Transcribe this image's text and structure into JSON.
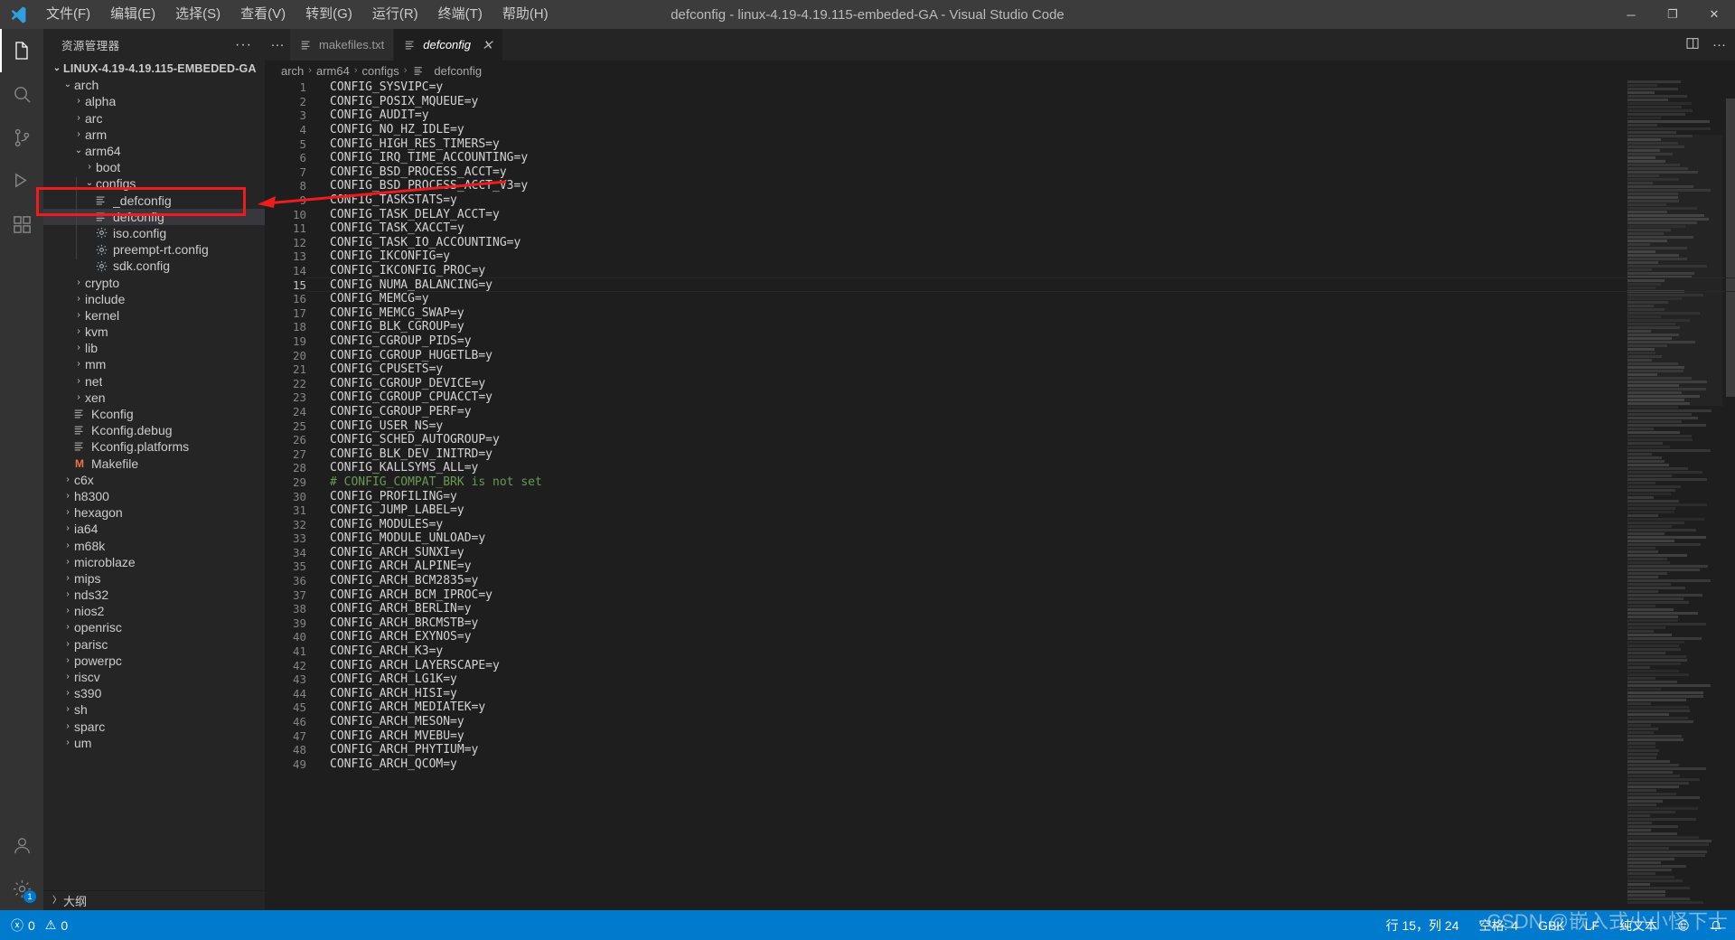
{
  "titlebar": {
    "window_title": "defconfig - linux-4.19-4.19.115-embeded-GA - Visual Studio Code",
    "menus": [
      "文件(F)",
      "编辑(E)",
      "选择(S)",
      "查看(V)",
      "转到(G)",
      "运行(R)",
      "终端(T)",
      "帮助(H)"
    ],
    "minimize": "─",
    "maximize": "❐",
    "close": "✕"
  },
  "activity_bar": {
    "items": [
      {
        "name": "explorer",
        "icon": "files-icon",
        "active": true
      },
      {
        "name": "search",
        "icon": "search-icon",
        "active": false
      },
      {
        "name": "source-control",
        "icon": "source-control-icon",
        "active": false
      },
      {
        "name": "run-and-debug",
        "icon": "debug-icon",
        "active": false
      },
      {
        "name": "extensions",
        "icon": "extensions-icon",
        "active": false
      }
    ],
    "bottom": [
      {
        "name": "accounts",
        "icon": "account-icon",
        "badge": ""
      },
      {
        "name": "manage",
        "icon": "gear-icon",
        "badge": "1"
      }
    ]
  },
  "sidebar": {
    "title": "资源管理器",
    "actions": "···",
    "outline_label": "大纲",
    "tree": [
      {
        "label": "LINUX-4.19-4.19.115-EMBEDED-GA",
        "indent": 0,
        "type": "root",
        "twisty": "open"
      },
      {
        "label": "arch",
        "indent": 1,
        "type": "folder",
        "twisty": "open"
      },
      {
        "label": "alpha",
        "indent": 2,
        "type": "folder",
        "twisty": "closed"
      },
      {
        "label": "arc",
        "indent": 2,
        "type": "folder",
        "twisty": "closed"
      },
      {
        "label": "arm",
        "indent": 2,
        "type": "folder",
        "twisty": "closed"
      },
      {
        "label": "arm64",
        "indent": 2,
        "type": "folder",
        "twisty": "open"
      },
      {
        "label": "boot",
        "indent": 3,
        "type": "folder",
        "twisty": "closed"
      },
      {
        "label": "configs",
        "indent": 3,
        "type": "folder",
        "twisty": "open"
      },
      {
        "label": "_defconfig",
        "indent": 4,
        "type": "file-text"
      },
      {
        "label": "defconfig",
        "indent": 4,
        "type": "file-text",
        "selected": true
      },
      {
        "label": "iso.config",
        "indent": 4,
        "type": "file-config"
      },
      {
        "label": "preempt-rt.config",
        "indent": 4,
        "type": "file-config"
      },
      {
        "label": "sdk.config",
        "indent": 4,
        "type": "file-config"
      },
      {
        "label": "crypto",
        "indent": 2,
        "type": "folder",
        "twisty": "closed"
      },
      {
        "label": "include",
        "indent": 2,
        "type": "folder",
        "twisty": "closed"
      },
      {
        "label": "kernel",
        "indent": 2,
        "type": "folder",
        "twisty": "closed"
      },
      {
        "label": "kvm",
        "indent": 2,
        "type": "folder",
        "twisty": "closed"
      },
      {
        "label": "lib",
        "indent": 2,
        "type": "folder",
        "twisty": "closed"
      },
      {
        "label": "mm",
        "indent": 2,
        "type": "folder",
        "twisty": "closed"
      },
      {
        "label": "net",
        "indent": 2,
        "type": "folder",
        "twisty": "closed"
      },
      {
        "label": "xen",
        "indent": 2,
        "type": "folder",
        "twisty": "closed"
      },
      {
        "label": "Kconfig",
        "indent": 2,
        "type": "file-text"
      },
      {
        "label": "Kconfig.debug",
        "indent": 2,
        "type": "file-text"
      },
      {
        "label": "Kconfig.platforms",
        "indent": 2,
        "type": "file-text"
      },
      {
        "label": "Makefile",
        "indent": 2,
        "type": "file-make"
      },
      {
        "label": "c6x",
        "indent": 1,
        "type": "folder",
        "twisty": "closed"
      },
      {
        "label": "h8300",
        "indent": 1,
        "type": "folder",
        "twisty": "closed"
      },
      {
        "label": "hexagon",
        "indent": 1,
        "type": "folder",
        "twisty": "closed"
      },
      {
        "label": "ia64",
        "indent": 1,
        "type": "folder",
        "twisty": "closed"
      },
      {
        "label": "m68k",
        "indent": 1,
        "type": "folder",
        "twisty": "closed"
      },
      {
        "label": "microblaze",
        "indent": 1,
        "type": "folder",
        "twisty": "closed"
      },
      {
        "label": "mips",
        "indent": 1,
        "type": "folder",
        "twisty": "closed"
      },
      {
        "label": "nds32",
        "indent": 1,
        "type": "folder",
        "twisty": "closed"
      },
      {
        "label": "nios2",
        "indent": 1,
        "type": "folder",
        "twisty": "closed"
      },
      {
        "label": "openrisc",
        "indent": 1,
        "type": "folder",
        "twisty": "closed"
      },
      {
        "label": "parisc",
        "indent": 1,
        "type": "folder",
        "twisty": "closed"
      },
      {
        "label": "powerpc",
        "indent": 1,
        "type": "folder",
        "twisty": "closed"
      },
      {
        "label": "riscv",
        "indent": 1,
        "type": "folder",
        "twisty": "closed"
      },
      {
        "label": "s390",
        "indent": 1,
        "type": "folder",
        "twisty": "closed"
      },
      {
        "label": "sh",
        "indent": 1,
        "type": "folder",
        "twisty": "closed"
      },
      {
        "label": "sparc",
        "indent": 1,
        "type": "folder",
        "twisty": "closed"
      },
      {
        "label": "um",
        "indent": 1,
        "type": "folder",
        "twisty": "closed"
      }
    ]
  },
  "editor": {
    "tabs": [
      {
        "label": "makefiles.txt",
        "active": false,
        "icon": "file-text-icon"
      },
      {
        "label": "defconfig",
        "active": true,
        "icon": "file-text-icon",
        "close": "✕"
      }
    ],
    "tab_actions": [
      "split-editor-icon",
      "more-actions-icon"
    ],
    "breadcrumb": [
      "arch",
      "arm64",
      "configs",
      "defconfig"
    ],
    "breadcrumb_separator": "›",
    "current_line": 15,
    "lines": [
      {
        "n": 1,
        "text": "CONFIG_SYSVIPC=y"
      },
      {
        "n": 2,
        "text": "CONFIG_POSIX_MQUEUE=y"
      },
      {
        "n": 3,
        "text": "CONFIG_AUDIT=y"
      },
      {
        "n": 4,
        "text": "CONFIG_NO_HZ_IDLE=y"
      },
      {
        "n": 5,
        "text": "CONFIG_HIGH_RES_TIMERS=y"
      },
      {
        "n": 6,
        "text": "CONFIG_IRQ_TIME_ACCOUNTING=y"
      },
      {
        "n": 7,
        "text": "CONFIG_BSD_PROCESS_ACCT=y"
      },
      {
        "n": 8,
        "text": "CONFIG_BSD_PROCESS_ACCT_V3=y"
      },
      {
        "n": 9,
        "text": "CONFIG_TASKSTATS=y"
      },
      {
        "n": 10,
        "text": "CONFIG_TASK_DELAY_ACCT=y"
      },
      {
        "n": 11,
        "text": "CONFIG_TASK_XACCT=y"
      },
      {
        "n": 12,
        "text": "CONFIG_TASK_IO_ACCOUNTING=y"
      },
      {
        "n": 13,
        "text": "CONFIG_IKCONFIG=y"
      },
      {
        "n": 14,
        "text": "CONFIG_IKCONFIG_PROC=y"
      },
      {
        "n": 15,
        "text": "CONFIG_NUMA_BALANCING=y"
      },
      {
        "n": 16,
        "text": "CONFIG_MEMCG=y"
      },
      {
        "n": 17,
        "text": "CONFIG_MEMCG_SWAP=y"
      },
      {
        "n": 18,
        "text": "CONFIG_BLK_CGROUP=y"
      },
      {
        "n": 19,
        "text": "CONFIG_CGROUP_PIDS=y"
      },
      {
        "n": 20,
        "text": "CONFIG_CGROUP_HUGETLB=y"
      },
      {
        "n": 21,
        "text": "CONFIG_CPUSETS=y"
      },
      {
        "n": 22,
        "text": "CONFIG_CGROUP_DEVICE=y"
      },
      {
        "n": 23,
        "text": "CONFIG_CGROUP_CPUACCT=y"
      },
      {
        "n": 24,
        "text": "CONFIG_CGROUP_PERF=y"
      },
      {
        "n": 25,
        "text": "CONFIG_USER_NS=y"
      },
      {
        "n": 26,
        "text": "CONFIG_SCHED_AUTOGROUP=y"
      },
      {
        "n": 27,
        "text": "CONFIG_BLK_DEV_INITRD=y"
      },
      {
        "n": 28,
        "text": "CONFIG_KALLSYMS_ALL=y"
      },
      {
        "n": 29,
        "text": "# CONFIG_COMPAT_BRK is not set",
        "comment": true
      },
      {
        "n": 30,
        "text": "CONFIG_PROFILING=y"
      },
      {
        "n": 31,
        "text": "CONFIG_JUMP_LABEL=y"
      },
      {
        "n": 32,
        "text": "CONFIG_MODULES=y"
      },
      {
        "n": 33,
        "text": "CONFIG_MODULE_UNLOAD=y"
      },
      {
        "n": 34,
        "text": "CONFIG_ARCH_SUNXI=y"
      },
      {
        "n": 35,
        "text": "CONFIG_ARCH_ALPINE=y"
      },
      {
        "n": 36,
        "text": "CONFIG_ARCH_BCM2835=y"
      },
      {
        "n": 37,
        "text": "CONFIG_ARCH_BCM_IPROC=y"
      },
      {
        "n": 38,
        "text": "CONFIG_ARCH_BERLIN=y"
      },
      {
        "n": 39,
        "text": "CONFIG_ARCH_BRCMSTB=y"
      },
      {
        "n": 40,
        "text": "CONFIG_ARCH_EXYNOS=y"
      },
      {
        "n": 41,
        "text": "CONFIG_ARCH_K3=y"
      },
      {
        "n": 42,
        "text": "CONFIG_ARCH_LAYERSCAPE=y"
      },
      {
        "n": 43,
        "text": "CONFIG_ARCH_LG1K=y"
      },
      {
        "n": 44,
        "text": "CONFIG_ARCH_HISI=y"
      },
      {
        "n": 45,
        "text": "CONFIG_ARCH_MEDIATEK=y"
      },
      {
        "n": 46,
        "text": "CONFIG_ARCH_MESON=y"
      },
      {
        "n": 47,
        "text": "CONFIG_ARCH_MVEBU=y"
      },
      {
        "n": 48,
        "text": "CONFIG_ARCH_PHYTIUM=y"
      },
      {
        "n": 49,
        "text": "CONFIG_ARCH_QCOM=y"
      }
    ]
  },
  "statusbar": {
    "errors": "0",
    "warnings": "0",
    "error_icon": "ⓧ",
    "warning_icon": "⚠",
    "cursor_position": "行 15，列 24",
    "indentation": "空格: 4",
    "encoding": "GBK",
    "eol": "LF",
    "language": "纯文本",
    "feedback_icon": "smiley-icon",
    "bell_icon": "bell-icon"
  },
  "annotations": {
    "watermark": "CSDN @嵌入式小小怪下士",
    "highlight_color": "#ee1c1c"
  }
}
